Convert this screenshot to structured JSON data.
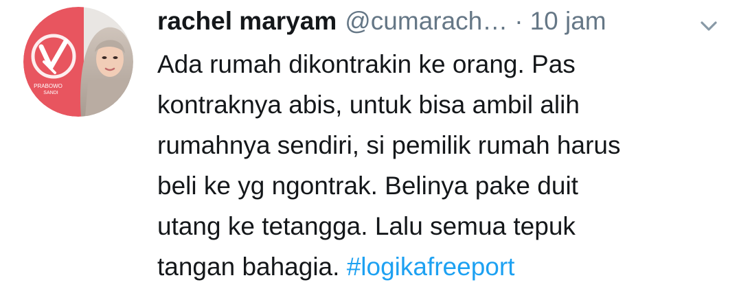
{
  "tweet": {
    "avatar": {
      "logo_text_line1": "PRABOWO",
      "logo_text_line2": "SANDI",
      "logo_color": "#e8555f"
    },
    "author": {
      "name": "rachel maryam",
      "handle": "@cumarach…",
      "separator": "·",
      "time": "10 jam"
    },
    "menu_icon": "chevron-down-icon",
    "text": {
      "line1": "Ada rumah dikontrakin ke orang. Pas",
      "line2": "kontraknya abis, untuk bisa ambil alih",
      "line3": "rumahnya sendiri, si pemilik rumah harus",
      "line4": "beli ke yg ngontrak. Belinya pake duit",
      "line5": "utang ke tetangga. Lalu semua tepuk",
      "line6_prefix": "tangan bahagia.",
      "hashtag": "#logikafreeport"
    },
    "colors": {
      "text": "#14171a",
      "muted": "#657786",
      "hashtag": "#1da1f2"
    }
  }
}
